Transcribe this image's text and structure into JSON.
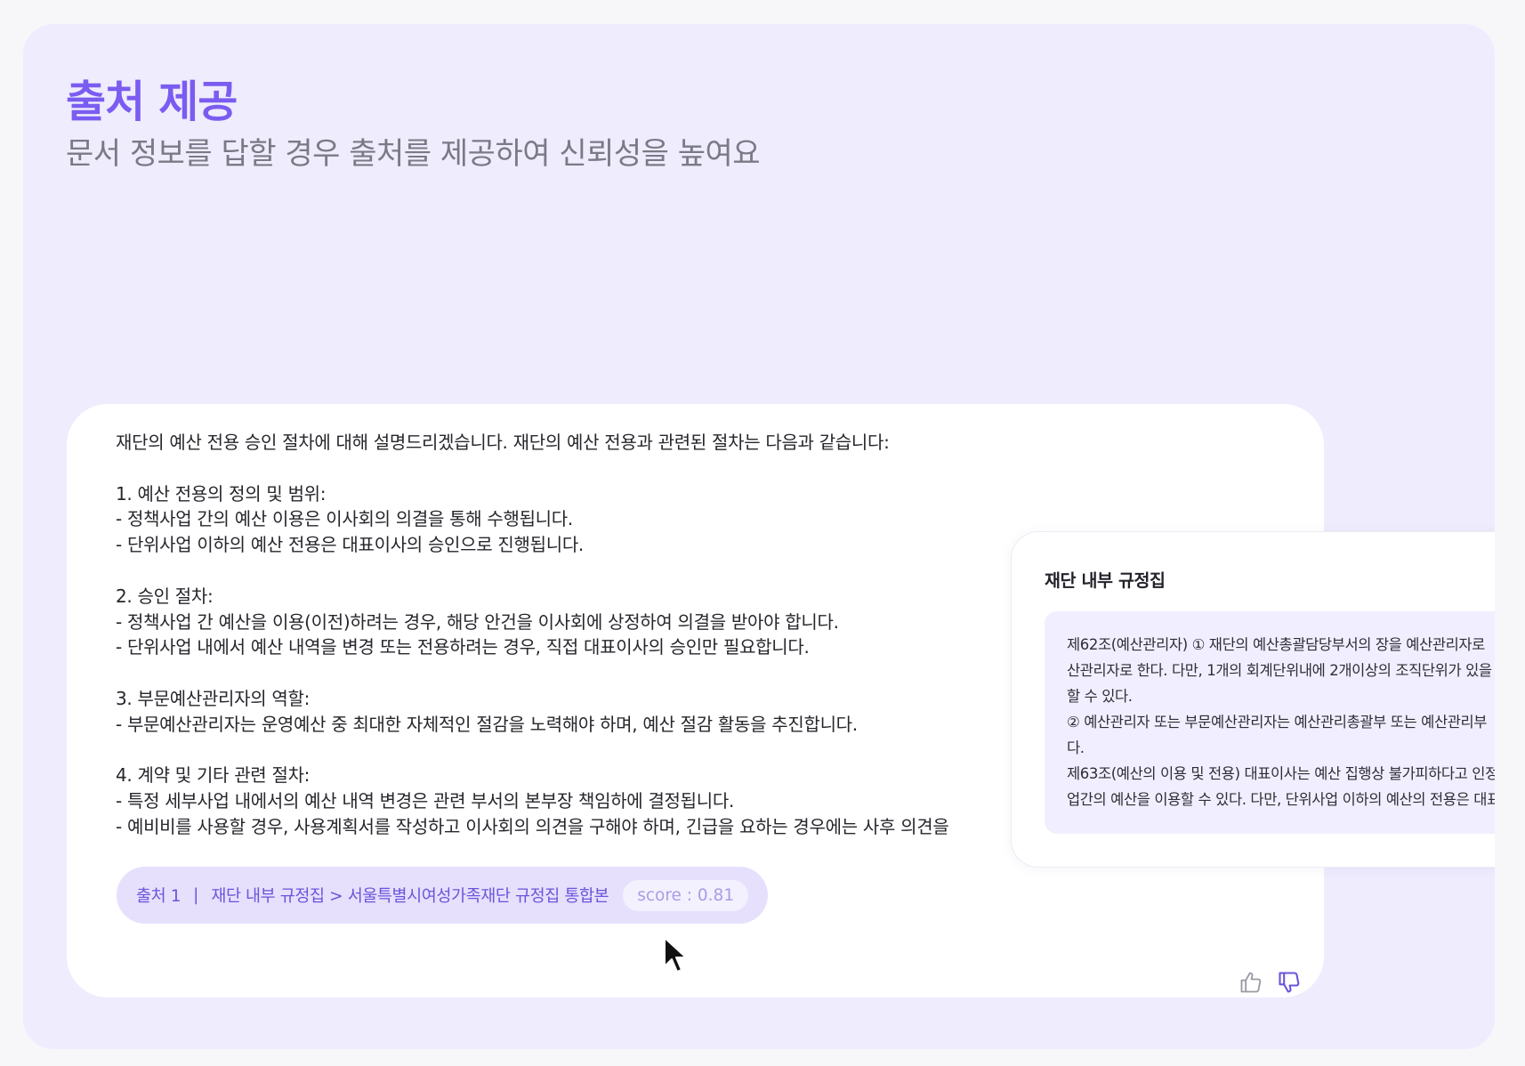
{
  "header": {
    "title": "출처 제공",
    "subtitle": "문서 정보를 답할 경우 출처를 제공하여 신뢰성을 높여요"
  },
  "answer": {
    "intro": "재단의 예산 전용 승인 절차에 대해 설명드리겠습니다. 재단의 예산 전용과 관련된 절차는 다음과 같습니다:",
    "s1_title": "1. 예산 전용의 정의 및 범위:",
    "s1_l1": "- 정책사업 간의 예산 이용은 이사회의 의결을 통해 수행됩니다.",
    "s1_l2": "- 단위사업 이하의 예산 전용은 대표이사의 승인으로 진행됩니다.",
    "s2_title": "2. 승인 절차:",
    "s2_l1": "- 정책사업 간 예산을 이용(이전)하려는 경우, 해당 안건을 이사회에 상정하여 의결을 받아야 합니다.",
    "s2_l2": "- 단위사업 내에서 예산 내역을 변경 또는 전용하려는 경우, 직접 대표이사의 승인만 필요합니다.",
    "s3_title": "3. 부문예산관리자의 역할:",
    "s3_l1": "- 부문예산관리자는 운영예산 중 최대한 자체적인 절감을 노력해야 하며, 예산 절감 활동을 추진합니다.",
    "s4_title": "4. 계약 및 기타 관련 절차:",
    "s4_l1": "- 특정 세부사업 내에서의 예산 내역 변경은 관련 부서의 본부장 책임하에 결정됩니다.",
    "s4_l2": "- 예비비를 사용할 경우, 사용계획서를 작성하고 이사회의 의견을 구해야 하며, 긴급을 요하는 경우에는 사후 의견을"
  },
  "source": {
    "label": "출처 1",
    "separator": "|",
    "path": "재단 내부 규정집 > 서울특별시여성가족재단 규정집 통합본",
    "score": "score : 0.81"
  },
  "reference": {
    "title": "재단 내부 규정집",
    "lines": [
      "제62조(예산관리자) ① 재단의 예산총괄담당부서의 장을 예산관리자로",
      "산관리자로 한다. 다만, 1개의 회계단위내에 2개이상의 조직단위가 있을",
      "할 수 있다.",
      "② 예산관리자 또는 부문예산관리자는 예산관리총괄부 또는 예산관리부",
      "다.",
      "제63조(예산의 이용 및 전용) 대표이사는 예산 집행상 불가피하다고 인정",
      "업간의 예산을 이용할 수 있다. 다만, 단위사업 이하의 예산의 전용은 대표"
    ]
  },
  "icons": {
    "thumb_up": "thumb-up-icon",
    "thumb_down": "thumb-down-icon",
    "cursor": "mouse-cursor-icon"
  },
  "colors": {
    "accent": "#7b5cf0",
    "panel_bg": "#efecfe",
    "chip_bg": "#e6e0fd",
    "chip_text": "#6b55d9"
  }
}
